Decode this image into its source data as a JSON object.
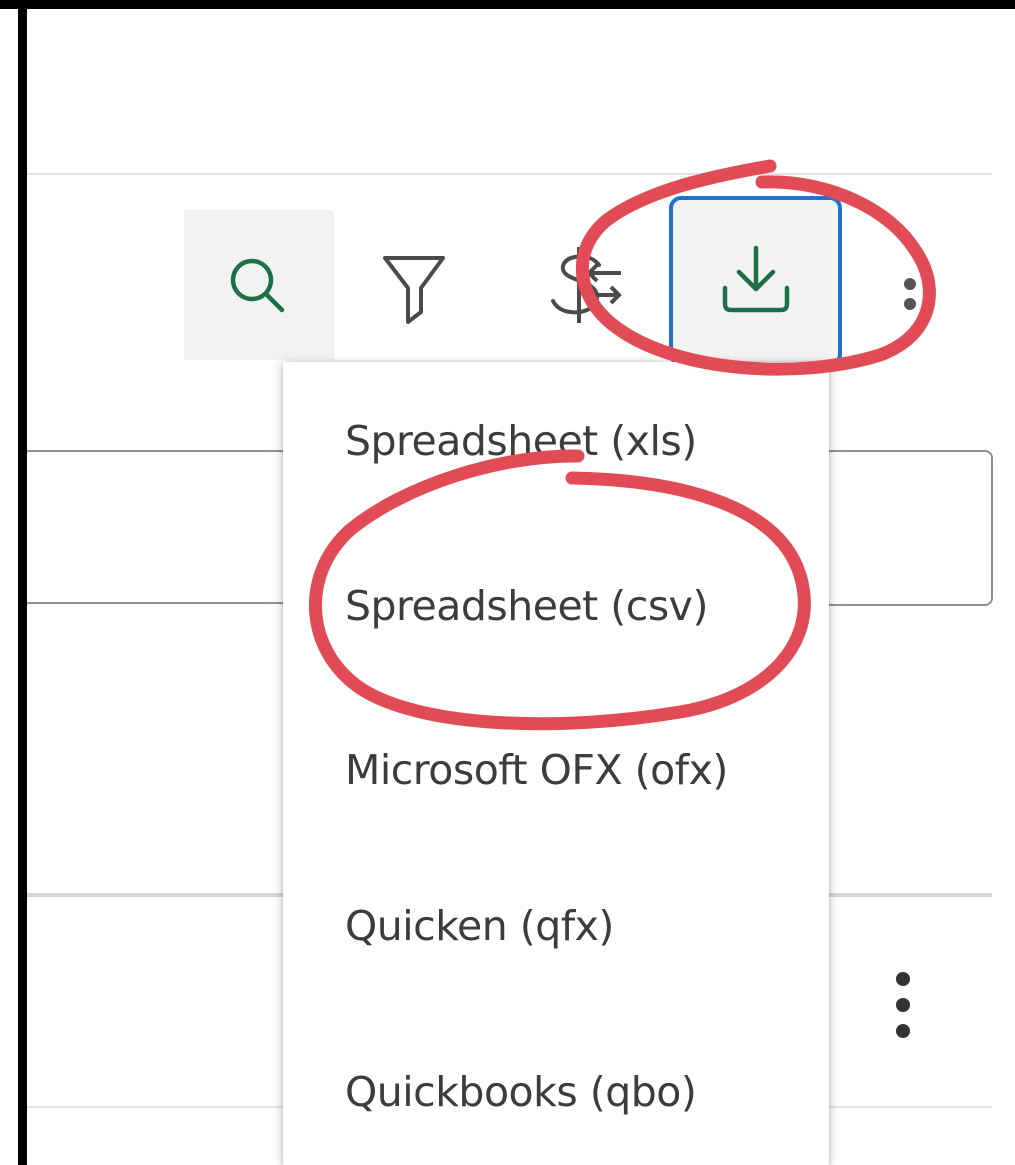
{
  "colors": {
    "accent_green": "#1e6f45",
    "focus_blue": "#1f73cf",
    "annotation_red": "#e14b55",
    "menu_text": "#3c3c3c"
  },
  "toolbar": {
    "icons": [
      "search-icon",
      "filter-icon",
      "dollar-transfer-icon",
      "download-icon",
      "more-vertical-icon"
    ]
  },
  "export_menu": {
    "items": [
      "Spreadsheet (xls)",
      "Spreadsheet (csv)",
      "Microsoft OFX (ofx)",
      "Quicken (qfx)",
      "Quickbooks (qbo)"
    ]
  }
}
